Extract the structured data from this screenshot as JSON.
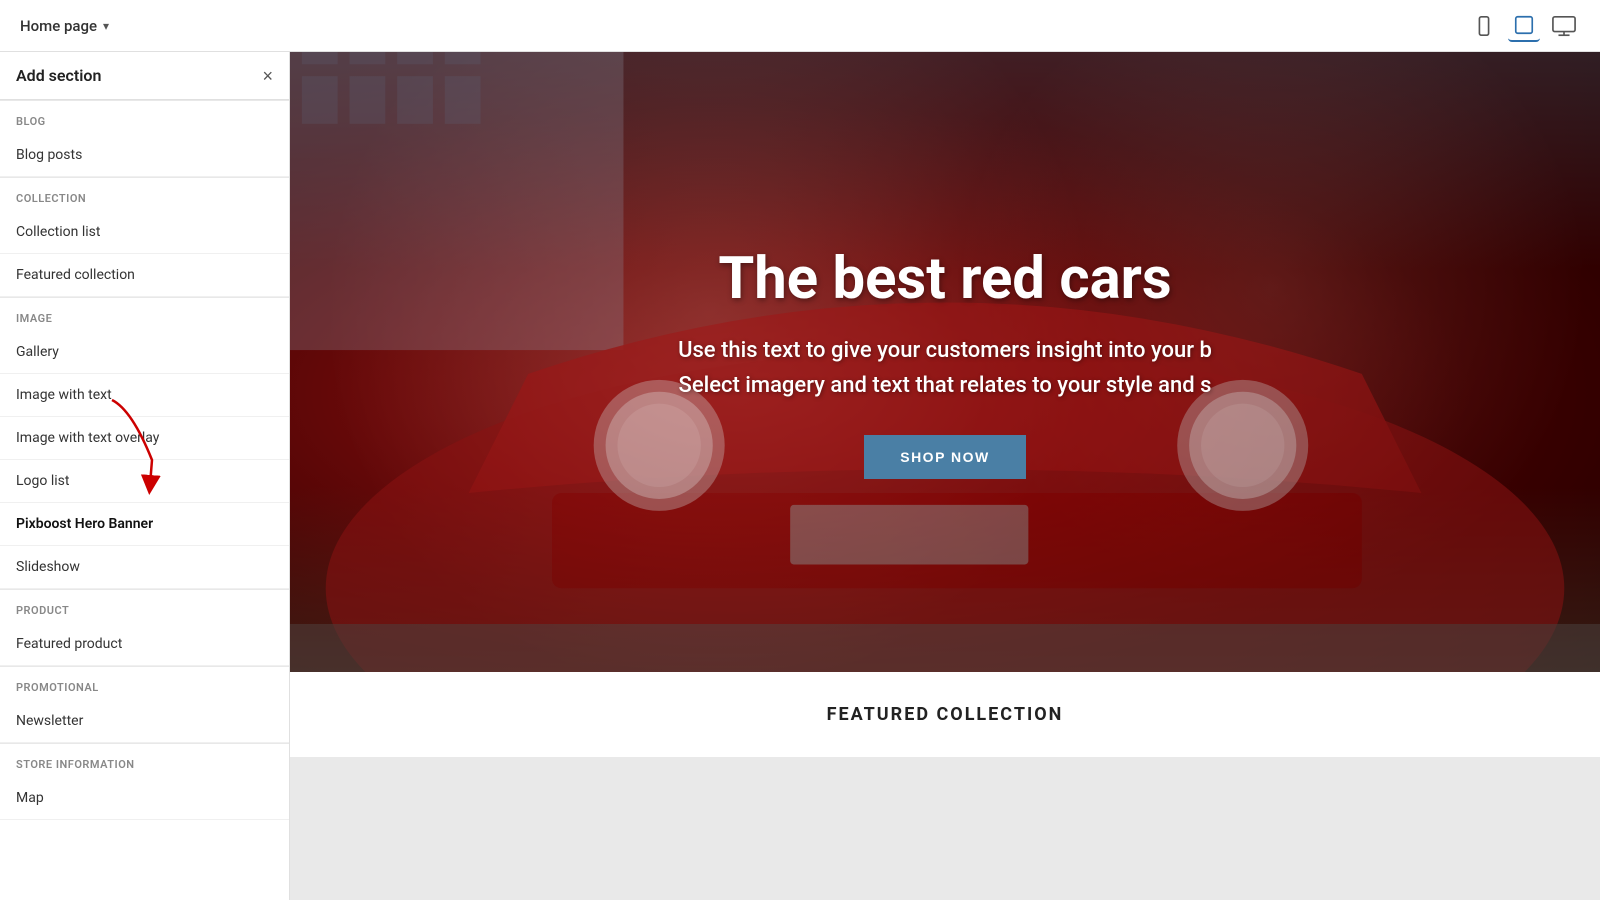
{
  "header": {
    "title": "Home page",
    "chevron": "▾",
    "close_label": "×"
  },
  "sidebar": {
    "title": "Add section",
    "sections": [
      {
        "label": "BLOG",
        "items": [
          "Blog posts"
        ]
      },
      {
        "label": "COLLECTION",
        "items": [
          "Collection list",
          "Featured collection"
        ]
      },
      {
        "label": "IMAGE",
        "items": [
          "Gallery",
          "Image with text",
          "Image with text overlay",
          "Logo list",
          "Pixboost Hero Banner",
          "Slideshow"
        ]
      },
      {
        "label": "PRODUCT",
        "items": [
          "Featured product"
        ]
      },
      {
        "label": "PROMOTIONAL",
        "items": [
          "Newsletter"
        ]
      },
      {
        "label": "STORE INFORMATION",
        "items": [
          "Map"
        ]
      }
    ],
    "highlighted_item": "Pixboost Hero Banner"
  },
  "hero": {
    "title": "The best red cars",
    "subtitle_line1": "Use this text to give your customers insight into your b",
    "subtitle_line2": "Select imagery and text that relates to your style and s",
    "button_label": "SHOP NOW"
  },
  "featured_collection": {
    "label": "FEATURED COLLECTION"
  },
  "view_icons": {
    "mobile": "📱",
    "tablet": "💻",
    "desktop": "🖥"
  }
}
